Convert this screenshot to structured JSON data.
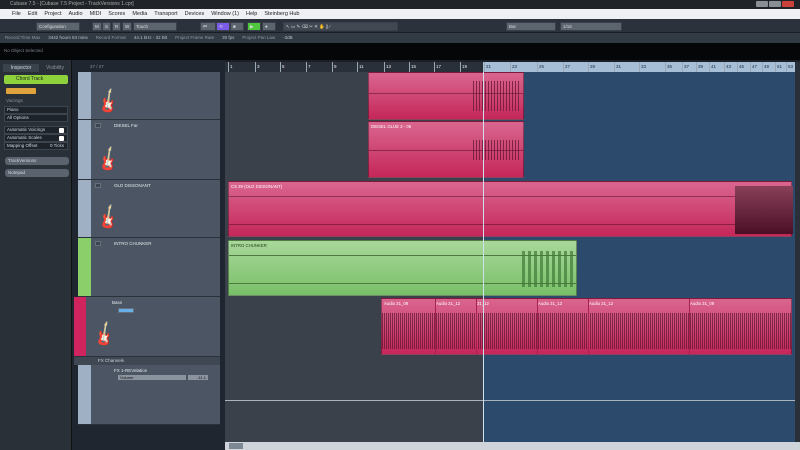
{
  "window": {
    "title": "Cubase 7.5 - [Cubase 7.5 Project - TrackVersions 1.cpr]"
  },
  "menu": [
    "File",
    "Edit",
    "Project",
    "Audio",
    "MIDI",
    "Scores",
    "Media",
    "Transport",
    "Devices",
    "Window (1)",
    "Help",
    "Steinberg Hub"
  ],
  "toolbar": {
    "configuration": "Configuration",
    "m": "M",
    "s": "S",
    "r": "R",
    "w": "W",
    "automation_mode": "Touch",
    "grid_type": "Bar",
    "quantize": "1/16"
  },
  "infoline": [
    {
      "label": "Record Time Max",
      "value": "3442 hours 53 mins"
    },
    {
      "label": "Record Format",
      "value": "44.1 kHz - 32 Bit"
    },
    {
      "label": "Project Frame Rate",
      "value": "30 fps"
    },
    {
      "label": "Project Pan Law",
      "value": "-3dB"
    }
  ],
  "status": "No Object Selected",
  "inspector": {
    "tabs": [
      "Inspector",
      "Visibility"
    ],
    "track": "Chord Track",
    "voicings_label": "Voicings",
    "voicing": "Piano",
    "options": "All Options",
    "auto_voicings": "Automatic Voicings",
    "auto_scales": "Automatic Scales",
    "mapping_offset": "Mapping Offset",
    "mapping_value": "0 Ticks",
    "track_versions": "TrackVersions",
    "notepad": "Notepad"
  },
  "tracklist": {
    "count": "27 / 27",
    "tracks": [
      {
        "name": "DIESEL Far",
        "color": "#9fb0c4"
      },
      {
        "name": "OLD DISSONANT",
        "color": "#9fb0c4"
      },
      {
        "name": "INTRO CHUNKER",
        "color": "#8bcf6a"
      },
      {
        "name": "Bass",
        "color": "#d0245f"
      }
    ],
    "folder": "FX Channels",
    "fx": {
      "name": "FX 1-REVelation",
      "param": "Volume",
      "value": "-11.1"
    }
  },
  "ruler": [
    "1",
    "3",
    "5",
    "7",
    "9",
    "11",
    "13",
    "15",
    "17",
    "19",
    "21",
    "23",
    "25",
    "27",
    "29",
    "31",
    "33",
    "35",
    "37",
    "39",
    "41",
    "43",
    "45",
    "47",
    "49",
    "51",
    "53"
  ],
  "events": {
    "diesel": "DIESEL GLUE 2 - 06",
    "old": "CS 29 (OLD DISSONANT)",
    "intro": "INTRO CHUNKER",
    "bass": [
      "Audio 31_09",
      "Audio 31_12",
      "31_12",
      "Audio 31_12",
      "Audio 31_12",
      "Audio 31_09"
    ]
  }
}
